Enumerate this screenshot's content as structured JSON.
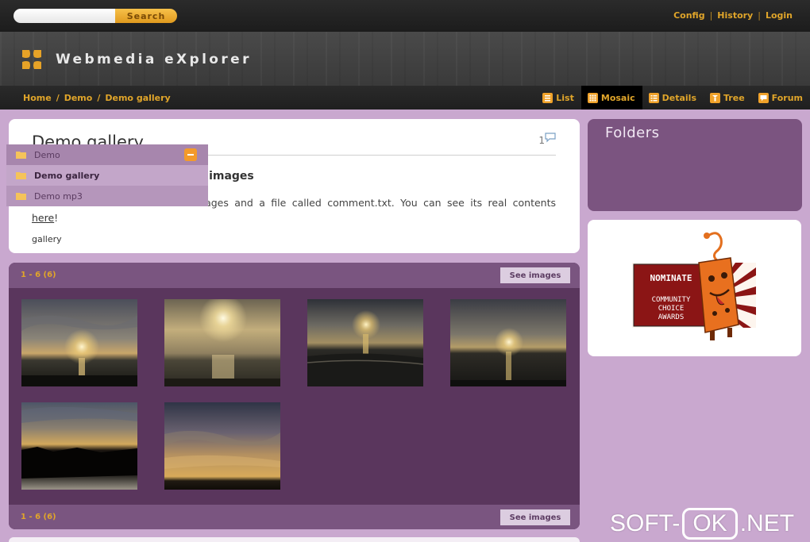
{
  "search": {
    "placeholder": "",
    "button_label": "Search"
  },
  "top_links": [
    "Config",
    "History",
    "Login"
  ],
  "top_links_separator": "|",
  "site": {
    "title": "Webmedia eXplorer"
  },
  "breadcrumb": {
    "items": [
      "Home",
      "Demo",
      "Demo gallery"
    ],
    "separator": "/"
  },
  "view_tabs": [
    {
      "label": "List",
      "icon": "list-icon",
      "active": false
    },
    {
      "label": "Mosaic",
      "icon": "mosaic-icon",
      "active": true
    },
    {
      "label": "Details",
      "icon": "details-icon",
      "active": false
    },
    {
      "label": "Tree",
      "icon": "tree-icon",
      "active": false
    },
    {
      "label": "Forum",
      "icon": "forum-icon",
      "active": false
    }
  ],
  "folder_info": {
    "title": "Demo gallery",
    "comment_count": "1",
    "subtitle": "Demo of a folder with some images",
    "text_before_link": "In this folder there are some images and a file called comment.txt. You can see its real contents ",
    "link_text": "here",
    "text_after_link": "!",
    "tag": "gallery"
  },
  "gallery": {
    "range_label": "1 - 6 (6)",
    "see_images_label": "See images",
    "thumbnail_count": 6
  },
  "folders": {
    "title": "Folders",
    "items": [
      {
        "label": "Demo",
        "state": "expanded"
      },
      {
        "label": "Demo gallery",
        "state": "selected"
      },
      {
        "label": "Demo mp3",
        "state": "normal"
      }
    ]
  },
  "award": {
    "lines": [
      "NOMINATE",
      "COMMUNITY",
      "CHOICE",
      "AWARDS"
    ]
  },
  "watermark": {
    "left": "SOFT-",
    "boxed": "OK",
    "right": ".NET"
  },
  "colors": {
    "accent": "#e0a52a",
    "topbar": "#222222",
    "page_bg": "#c9a8cf",
    "panel_purple": "#5a365d",
    "folder_button": "#f39a2b"
  }
}
